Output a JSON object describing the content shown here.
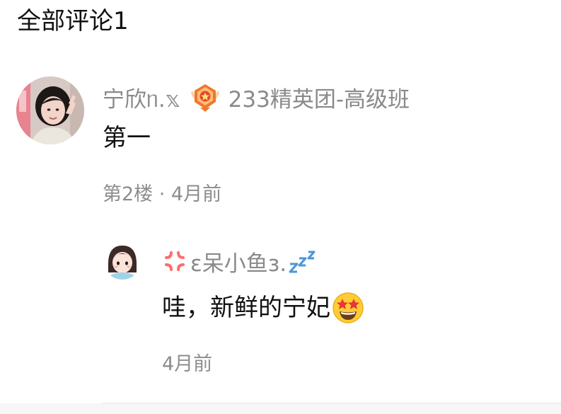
{
  "header": {
    "title": "全部评论1"
  },
  "comment": {
    "username": "宁欣ᥒ.𝕩",
    "badge_icon": "medal-badge-icon",
    "group_name": "233精英团-高级班",
    "text": "第一",
    "floor_time": "第2楼 · 4月前"
  },
  "reply": {
    "username_prefix_icon": "anger-symbol-icon",
    "username": "ε呆小鱼з.",
    "username_suffix_icon": "zzz-icon",
    "text": "哇，新鲜的宁妃",
    "text_emoji": "star-struck-emoji-icon",
    "time": "4月前"
  },
  "colors": {
    "primary_text": "#111111",
    "secondary_text": "#8a8a8a",
    "badge_orange": "#f0782a",
    "anger_red": "#ff6d6d",
    "emoji_yellow": "#ffcc33"
  }
}
